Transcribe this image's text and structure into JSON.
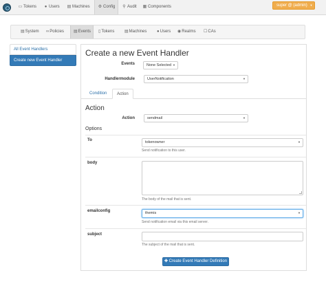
{
  "navbar": {
    "items": [
      {
        "label": "Tokens",
        "icon": "tag-icon"
      },
      {
        "label": "Users",
        "icon": "user-icon"
      },
      {
        "label": "Machines",
        "icon": "server-icon"
      },
      {
        "label": "Config",
        "icon": "gear-icon"
      },
      {
        "label": "Audit",
        "icon": "search-icon"
      },
      {
        "label": "Components",
        "icon": "cubes-icon"
      }
    ],
    "user_label": "super @ (admin)"
  },
  "subtabs": [
    {
      "label": "System",
      "icon": "server-icon"
    },
    {
      "label": "Policies",
      "icon": "link-icon"
    },
    {
      "label": "Events",
      "icon": "flash-icon"
    },
    {
      "label": "Tokens",
      "icon": "phone-icon"
    },
    {
      "label": "Machines",
      "icon": "server-icon"
    },
    {
      "label": "Users",
      "icon": "user-icon"
    },
    {
      "label": "Realms",
      "icon": "globe-icon"
    },
    {
      "label": "CAs",
      "icon": "certificate-icon"
    }
  ],
  "sidebar": {
    "all_label": "All Event Handlers",
    "create_label": "Create new Event Handler"
  },
  "form": {
    "title": "Create a new Event Handler",
    "events_label": "Events",
    "events_value": "None Selected",
    "handlermodule_label": "Handlermodule",
    "handlermodule_value": "UserNotification",
    "tabs": {
      "condition": "Condition",
      "action": "Action"
    },
    "action_section": "Action",
    "action_label": "Action",
    "action_value": "sendmail",
    "options_title": "Options",
    "options": {
      "to": {
        "label": "To",
        "value": "tokenowner",
        "help": "Send notification to this user."
      },
      "body": {
        "label": "body",
        "help": "The body of the mail that is sent."
      },
      "emailconfig": {
        "label": "emailconfig",
        "value": "themis",
        "help": "Send notification email via this email server."
      },
      "subject": {
        "label": "subject",
        "help": "The subject of the mail that is sent."
      }
    },
    "submit_label": "Create Event Handler Definition"
  },
  "colors": {
    "primary": "#337ab7",
    "user_button": "#f0ad4e",
    "navbar": "#f2f2f2"
  }
}
